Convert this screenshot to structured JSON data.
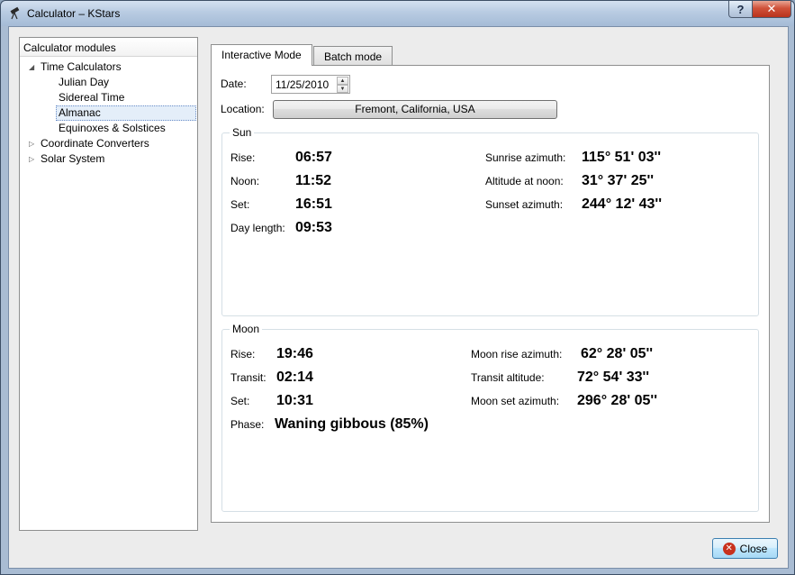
{
  "window": {
    "title": "Calculator – KStars",
    "help_label": "?",
    "close_label": "✕"
  },
  "tree": {
    "header": "Calculator modules",
    "items": [
      {
        "label": "Time Calculators",
        "expanded": true
      },
      {
        "label": "Julian Day"
      },
      {
        "label": "Sidereal Time"
      },
      {
        "label": "Almanac",
        "selected": true
      },
      {
        "label": "Equinoxes & Solstices"
      },
      {
        "label": "Coordinate Converters",
        "expanded": false
      },
      {
        "label": "Solar System",
        "expanded": false
      }
    ]
  },
  "tabs": [
    {
      "label": "Interactive Mode",
      "active": true
    },
    {
      "label": "Batch mode",
      "active": false
    }
  ],
  "form": {
    "date_label": "Date:",
    "date_value": "11/25/2010",
    "location_label": "Location:",
    "location_value": "Fremont, California, USA"
  },
  "sun": {
    "title": "Sun",
    "rise_label": "Rise:",
    "rise": "06:57",
    "noon_label": "Noon:",
    "noon": "11:52",
    "set_label": "Set:",
    "set": "16:51",
    "daylength_label": "Day length:",
    "daylength": "09:53",
    "rise_az_label": "Sunrise azimuth:",
    "rise_az": "115° 51' 03''",
    "alt_noon_label": "Altitude at noon:",
    "alt_noon": "31° 37' 25''",
    "set_az_label": "Sunset azimuth:",
    "set_az": "244° 12' 43''"
  },
  "moon": {
    "title": "Moon",
    "rise_label": "Rise:",
    "rise": "19:46",
    "transit_label": "Transit:",
    "transit": "02:14",
    "set_label": "Set:",
    "set": "10:31",
    "phase_label": "Phase:",
    "phase": "Waning gibbous (85%)",
    "rise_az_label": "Moon rise azimuth:",
    "rise_az": "62° 28' 05''",
    "transit_alt_label": "Transit altitude:",
    "transit_alt": "72° 54' 33''",
    "set_az_label": "Moon set azimuth:",
    "set_az": "296° 28' 05''"
  },
  "footer": {
    "close_label": "Close"
  }
}
